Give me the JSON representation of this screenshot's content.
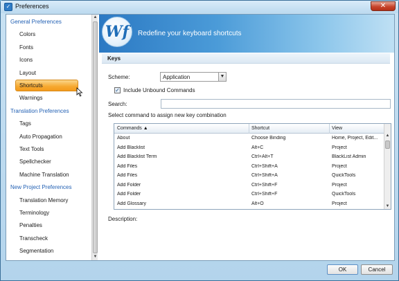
{
  "window": {
    "title": "Preferences",
    "close_label": "✕",
    "app_icon_glyph": "✓"
  },
  "nav": {
    "items": [
      {
        "label": "General Preferences",
        "type": "category"
      },
      {
        "label": "Colors",
        "type": "item"
      },
      {
        "label": "Fonts",
        "type": "item"
      },
      {
        "label": "Icons",
        "type": "item"
      },
      {
        "label": "Layout",
        "type": "item"
      },
      {
        "label": "Shortcuts",
        "type": "item",
        "selected": true
      },
      {
        "label": "Warnings",
        "type": "item"
      },
      {
        "label": "Translation Preferences",
        "type": "category"
      },
      {
        "label": "Tags",
        "type": "item"
      },
      {
        "label": "Auto Propagation",
        "type": "item"
      },
      {
        "label": "Text Tools",
        "type": "item"
      },
      {
        "label": "Spellchecker",
        "type": "item"
      },
      {
        "label": "Machine Translation",
        "type": "item"
      },
      {
        "label": "New Project Preferences",
        "type": "category"
      },
      {
        "label": "Translation Memory",
        "type": "item"
      },
      {
        "label": "Terminology",
        "type": "item"
      },
      {
        "label": "Penalties",
        "type": "item"
      },
      {
        "label": "Transcheck",
        "type": "item"
      },
      {
        "label": "Segmentation",
        "type": "item"
      }
    ]
  },
  "header": {
    "logo_text": "Wf",
    "title": "Redefine your keyboard shortcuts"
  },
  "keys": {
    "section_title": "Keys",
    "scheme_label": "Scheme:",
    "scheme_value": "Application",
    "include_unbound_label": "Include Unbound Commands",
    "include_unbound_checked": true,
    "search_label": "Search:",
    "search_value": "",
    "instruction": "Select command to assign new key combination",
    "description_label": "Description:"
  },
  "table": {
    "columns": [
      "Commands ▲",
      "Shortcut",
      "View"
    ],
    "rows": [
      [
        "About",
        "Choose Binding",
        "Home, Project, Edit..."
      ],
      [
        "Add Blacklist",
        "Alt+C",
        "Project"
      ],
      [
        "Add Blacklist Term",
        "Ctrl+Alt+T",
        "BlackList Admin"
      ],
      [
        "Add Files",
        "Ctrl+Shift+A",
        "Project"
      ],
      [
        "Add Files",
        "Ctrl+Shift+A",
        "QuickTools"
      ],
      [
        "Add Folder",
        "Ctrl+Shift+F",
        "Project"
      ],
      [
        "Add Folder",
        "Ctrl+Shift+F",
        "QuickTools"
      ],
      [
        "Add Glossary",
        "Alt+O",
        "Project"
      ]
    ]
  },
  "footer": {
    "ok_label": "OK",
    "cancel_label": "Cancel"
  }
}
